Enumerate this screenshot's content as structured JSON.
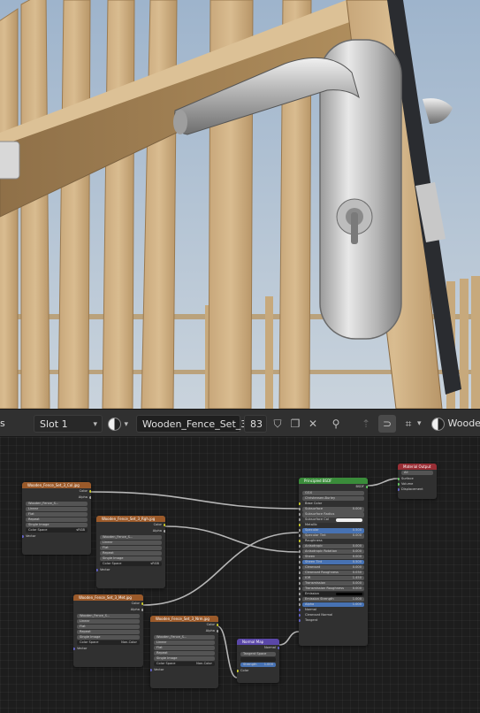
{
  "header": {
    "left_label": "s",
    "slot": "Slot 1",
    "material_name": "Wooden_Fence_Set_3",
    "user_count": "83",
    "right_material": "Woode"
  },
  "nodes": {
    "tex1": {
      "title": "Wooden_Fence_Set_3_Col.jpg",
      "out1": "Color",
      "out2": "Alpha",
      "image": "Wooden_Fence_S...",
      "interp": "Linear",
      "proj": "Flat",
      "ext": "Repeat",
      "src": "Single Image",
      "cs_label": "Color Space",
      "cs_value": "sRGB",
      "vector": "Vector"
    },
    "tex2": {
      "title": "Wooden_Fence_Set_3_Rgh.jpg",
      "out1": "Color",
      "out2": "Alpha",
      "image": "Wooden_Fence_S...",
      "interp": "Linear",
      "proj": "Flat",
      "ext": "Repeat",
      "src": "Single Image",
      "cs_label": "Color Space",
      "cs_value": "sRGB",
      "vector": "Vector"
    },
    "tex3": {
      "title": "Wooden_Fence_Set_3_Met.jpg",
      "out1": "Color",
      "out2": "Alpha",
      "image": "Wooden_Fence_S...",
      "interp": "Linear",
      "proj": "Flat",
      "ext": "Repeat",
      "src": "Single Image",
      "cs_label": "Color Space",
      "cs_value": "Non-Color",
      "vector": "Vector"
    },
    "tex4": {
      "title": "Wooden_Fence_Set_3_Nrm.jpg",
      "out1": "Color",
      "out2": "Alpha",
      "image": "Wooden_Fence_S...",
      "interp": "Linear",
      "proj": "Flat",
      "ext": "Repeat",
      "src": "Single Image",
      "cs_label": "Color Space",
      "cs_value": "Non-Color",
      "vector": "Vector"
    },
    "normal_map": {
      "title": "Normal Map",
      "out": "Normal",
      "space": "Tangent Space",
      "uv": "",
      "strength_label": "Strength",
      "strength": "1.000",
      "color": "Color"
    },
    "bsdf": {
      "title": "Principled BSDF",
      "out": "BSDF",
      "distribution": "GGX",
      "subsurface_method": "Christensen-Burley",
      "inputs": [
        {
          "label": "Base Color",
          "value": "",
          "kind": "socket"
        },
        {
          "label": "Subsurface",
          "value": "0.000",
          "kind": "field"
        },
        {
          "label": "Subsurface Radius",
          "value": "",
          "kind": "field"
        },
        {
          "label": "Subsurface Col",
          "value": "",
          "kind": "white"
        },
        {
          "label": "Metallic",
          "value": "",
          "kind": "socket"
        },
        {
          "label": "Specular",
          "value": "0.500",
          "kind": "blue"
        },
        {
          "label": "Specular Tint",
          "value": "0.000",
          "kind": "field"
        },
        {
          "label": "Roughness",
          "value": "",
          "kind": "socket"
        },
        {
          "label": "Anisotropic",
          "value": "0.000",
          "kind": "field"
        },
        {
          "label": "Anisotropic Rotation",
          "value": "0.000",
          "kind": "field"
        },
        {
          "label": "Sheen",
          "value": "0.000",
          "kind": "field"
        },
        {
          "label": "Sheen Tint",
          "value": "0.500",
          "kind": "blue"
        },
        {
          "label": "Clearcoat",
          "value": "0.000",
          "kind": "field"
        },
        {
          "label": "Clearcoat Roughness",
          "value": "0.030",
          "kind": "field"
        },
        {
          "label": "IOR",
          "value": "1.450",
          "kind": "field"
        },
        {
          "label": "Transmission",
          "value": "0.000",
          "kind": "field"
        },
        {
          "label": "Transmission Roughness",
          "value": "0.000",
          "kind": "field"
        },
        {
          "label": "Emission",
          "value": "",
          "kind": "dark"
        },
        {
          "label": "Emission Strength",
          "value": "1.000",
          "kind": "field"
        },
        {
          "label": "Alpha",
          "value": "1.000",
          "kind": "blue"
        },
        {
          "label": "Normal",
          "value": "",
          "kind": "socket"
        },
        {
          "label": "Clearcoat Normal",
          "value": "",
          "kind": "socket"
        },
        {
          "label": "Tangent",
          "value": "",
          "kind": "socket"
        }
      ]
    },
    "output": {
      "title": "Material Output",
      "target": "All",
      "in1": "Surface",
      "in2": "Volume",
      "in3": "Displacement"
    }
  }
}
